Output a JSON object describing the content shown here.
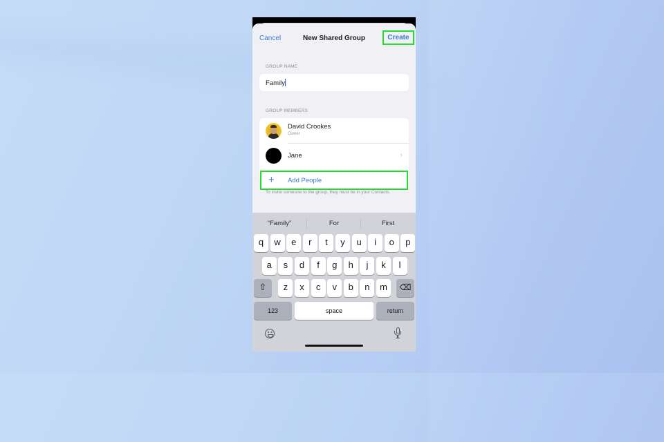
{
  "nav": {
    "cancel_label": "Cancel",
    "title": "New Shared Group",
    "create_label": "Create"
  },
  "group_name": {
    "section_label": "GROUP NAME",
    "value": "Family"
  },
  "group_members": {
    "section_label": "GROUP MEMBERS",
    "members": [
      {
        "name": "David Crookes",
        "role": "Owner",
        "avatar": "photo-avatar"
      },
      {
        "name": "Jane",
        "role": "",
        "avatar": "black-circle-avatar"
      }
    ],
    "add_label": "Add People",
    "footnote": "To invite someone to the group, they must be in your Contacts."
  },
  "keyboard": {
    "suggestions": [
      "“Family”",
      "For",
      "First"
    ],
    "row1": [
      "q",
      "w",
      "e",
      "r",
      "t",
      "y",
      "u",
      "i",
      "o",
      "p"
    ],
    "row2": [
      "a",
      "s",
      "d",
      "f",
      "g",
      "h",
      "j",
      "k",
      "l"
    ],
    "row3": [
      "z",
      "x",
      "c",
      "v",
      "b",
      "n",
      "m"
    ],
    "numbers_label": "123",
    "space_label": "space",
    "return_label": "return",
    "shift_icon": "⇧",
    "delete_icon": "⌫"
  },
  "colors": {
    "accent_blue": "#3a7dd6",
    "highlight_green": "#22e02a"
  }
}
